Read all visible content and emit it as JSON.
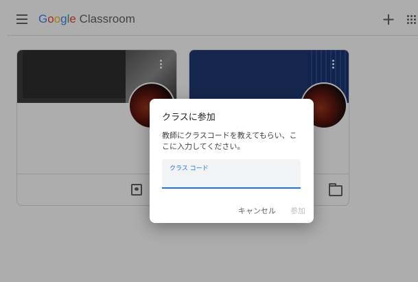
{
  "app": {
    "logo_google": [
      "G",
      "o",
      "o",
      "g",
      "l",
      "e"
    ],
    "logo_product": " Classroom"
  },
  "header": {
    "menu_icon": "hamburger-icon",
    "add_icon": "plus-icon",
    "apps_icon": "apps-grid-icon"
  },
  "dialog": {
    "title": "クラスに参加",
    "description": "教師にクラスコードを教えてもらい、ここに入力してください。",
    "input_label": "クラス コード",
    "input_value": "",
    "cancel_label": "キャンセル",
    "join_label": "参加",
    "join_enabled": false
  },
  "colors": {
    "accent": "#1a73e8",
    "scrim": "rgba(0,0,0,0.32)",
    "card2_header": "#1f3a73"
  }
}
